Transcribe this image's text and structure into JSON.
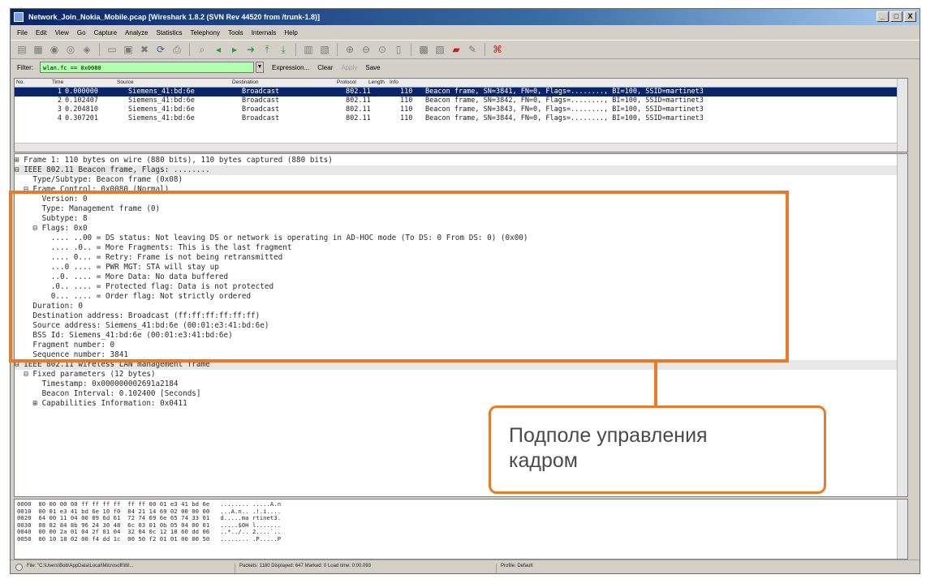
{
  "window": {
    "title": "Network_Join_Nokia_Mobile.pcap  [Wireshark 1.8.2  (SVN Rev 44520 from /trunk-1.8)]",
    "buttons": [
      "_",
      "□",
      "X"
    ]
  },
  "menu": [
    "File",
    "Edit",
    "View",
    "Go",
    "Capture",
    "Analyze",
    "Statistics",
    "Telephony",
    "Tools",
    "Internals",
    "Help"
  ],
  "filter": {
    "label": "Filter:",
    "value": "wlan.fc == 0x0080",
    "expression": "Expression...",
    "clear": "Clear",
    "apply": "Apply",
    "save": "Save"
  },
  "packet_list": {
    "columns": [
      "No.",
      "Time",
      "Source",
      "Destination",
      "Protocol",
      "Length",
      "Info"
    ],
    "rows": [
      {
        "no": "1",
        "time": "0.000000",
        "source": "Siemens_41:bd:6e",
        "destination": "Broadcast",
        "protocol": "802.11",
        "length": "110",
        "info": "Beacon frame, SN=3841, FN=0, Flags=........, BI=100, SSID=martinet3"
      },
      {
        "no": "2",
        "time": "0.102407",
        "source": "Siemens_41:bd:6e",
        "destination": "Broadcast",
        "protocol": "802.11",
        "length": "110",
        "info": "Beacon frame, SN=3842, FN=0, Flags=........, BI=100, SSID=martinet3"
      },
      {
        "no": "3",
        "time": "0.204810",
        "source": "Siemens_41:bd:6e",
        "destination": "Broadcast",
        "protocol": "802.11",
        "length": "110",
        "info": "Beacon frame, SN=3843, FN=0, Flags=........, BI=100, SSID=martinet3"
      },
      {
        "no": "4",
        "time": "0.307201",
        "source": "Siemens_41:bd:6e",
        "destination": "Broadcast",
        "protocol": "802.11",
        "length": "110",
        "info": "Beacon frame, SN=3844, FN=0, Flags=........, BI=100, SSID=martinet3"
      }
    ]
  },
  "details": [
    "⊞ Frame 1: 110 bytes on wire (880 bits), 110 bytes captured (880 bits)",
    "⊟ IEEE 802.11 Beacon frame, Flags: ........",
    "    Type/Subtype: Beacon frame (0x08)",
    "  ⊟ Frame Control: 0x0080 (Normal)",
    "      Version: 0",
    "      Type: Management frame (0)",
    "      Subtype: 8",
    "    ⊟ Flags: 0x0",
    "        .... ..00 = DS status: Not leaving DS or network is operating in AD-HOC mode (To DS: 0 From DS: 0) (0x00)",
    "        .... .0.. = More Fragments: This is the last fragment",
    "        .... 0... = Retry: Frame is not being retransmitted",
    "        ...0 .... = PWR MGT: STA will stay up",
    "        ..0. .... = More Data: No data buffered",
    "        .0.. .... = Protected flag: Data is not protected",
    "        0... .... = Order flag: Not strictly ordered",
    "    Duration: 0",
    "    Destination address: Broadcast (ff:ff:ff:ff:ff:ff)",
    "    Source address: Siemens_41:bd:6e (00:01:e3:41:bd:6e)",
    "    BSS Id: Siemens_41:bd:6e (00:01:e3:41:bd:6e)",
    "    Fragment number: 0",
    "    Sequence number: 3841",
    "⊟ IEEE 802.11 wireless LAN management frame",
    "  ⊟ Fixed parameters (12 bytes)",
    "      Timestamp: 0x000000002691a2184",
    "      Beacon Interval: 0.102400 [Seconds]",
    "    ⊞ Capabilities Information: 0x0411"
  ],
  "hex": [
    "0000  80 00 00 00 ff ff ff ff  ff ff 00 01 e3 41 bd 6e   ........ .....A.n",
    "0010  00 01 e3 41 bd 6e 10 f0  84 21 14 69 02 00 00 00   ...A.n.. .!.i....",
    "0020  64 00 11 04 00 09 6d 61  72 74 69 6e 65 74 33 01   d.....ma rtinet3.",
    "0030  08 82 84 8b 96 24 30 48  6c 03 01 0b 05 04 00 01   .....$0H l.......",
    "0040  00 00 2a 01 04 2f 01 04  32 04 0c 12 18 60 dd 06   ..*../.. 2....`..",
    "0050  00 10 18 02 00 f4 dd 1c  00 50 f2 01 01 00 00 50   ........ .P.....P"
  ],
  "status": {
    "file": "File: \"C:\\Users\\Bob\\AppData\\Local\\Microsoft\\Wi...",
    "packets": "Packets: 1180 Displayed: 647 Marked: 0 Load time: 0:00.093",
    "profile": "Profile: Default"
  },
  "annotation": {
    "line1": "Подполе управления",
    "line2": "кадром"
  },
  "colors": {
    "accent": "#e87a2a",
    "filter_valid": "#afffaf",
    "selection": "#0a246a"
  }
}
